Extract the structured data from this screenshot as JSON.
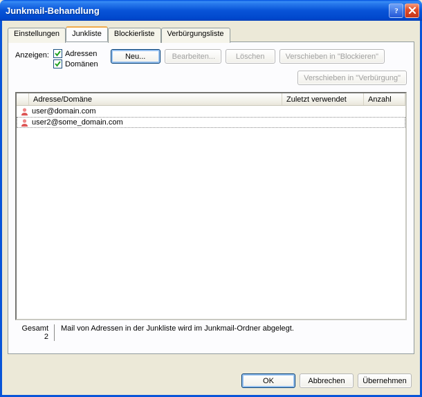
{
  "window": {
    "title": "Junkmail-Behandlung"
  },
  "tabs": [
    {
      "label": "Einstellungen"
    },
    {
      "label": "Junkliste"
    },
    {
      "label": "Blockierliste"
    },
    {
      "label": "Verbürgungsliste"
    }
  ],
  "anzeigen": {
    "label": "Anzeigen:",
    "adressen": "Adressen",
    "domaenen": "Domänen"
  },
  "buttons": {
    "neu": "Neu...",
    "bearbeiten": "Bearbeiten...",
    "loeschen": "Löschen",
    "versch_block": "Verschieben in \"Blockieren\"",
    "versch_verb": "Verschieben in \"Verbürgung\""
  },
  "columns": {
    "addr": "Adresse/Domäne",
    "zuletzt": "Zuletzt verwendet",
    "anzahl": "Anzahl"
  },
  "rows": [
    {
      "addr": "user@domain.com"
    },
    {
      "addr": "user2@some_domain.com"
    }
  ],
  "footer": {
    "gesamt_label": "Gesamt",
    "gesamt_value": "2",
    "desc": "Mail von Adressen in der Junkliste wird im Junkmail-Ordner abgelegt."
  },
  "dialog": {
    "ok": "OK",
    "cancel": "Abbrechen",
    "apply": "Übernehmen"
  }
}
